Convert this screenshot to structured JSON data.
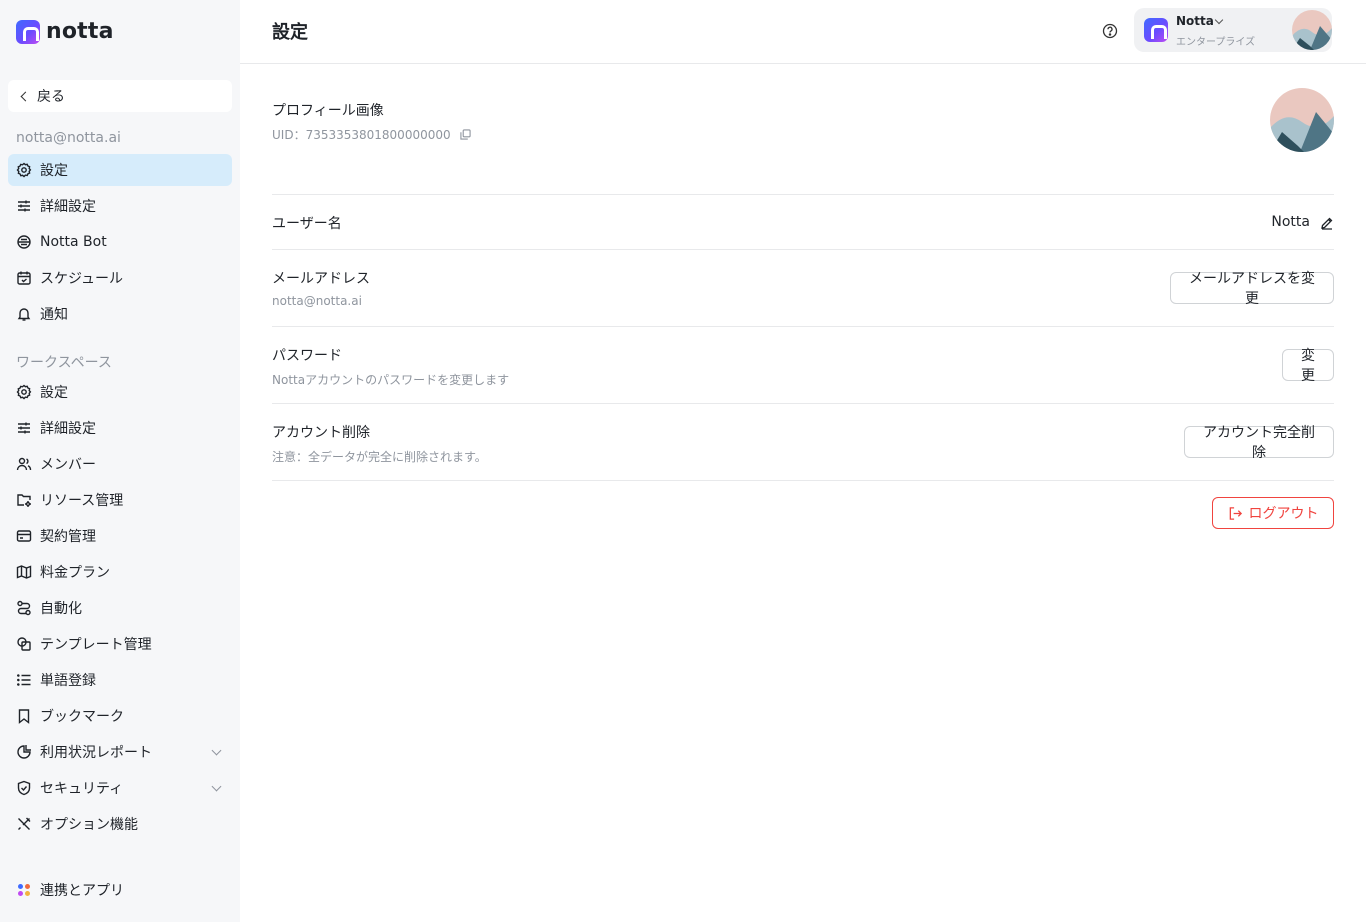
{
  "app": {
    "logo_text": "notta"
  },
  "sidebar": {
    "back_label": "戻る",
    "account_email": "notta@notta.ai",
    "personal_items": [
      {
        "label": "設定",
        "icon": "gear-icon",
        "active": true
      },
      {
        "label": "詳細設定",
        "icon": "sliders-icon"
      },
      {
        "label": "Notta Bot",
        "icon": "bot-icon"
      },
      {
        "label": "スケジュール",
        "icon": "calendar-icon"
      },
      {
        "label": "通知",
        "icon": "bell-icon"
      }
    ],
    "workspace_label": "ワークスペース",
    "workspace_items": [
      {
        "label": "設定",
        "icon": "gear-icon"
      },
      {
        "label": "詳細設定",
        "icon": "sliders-icon"
      },
      {
        "label": "メンバー",
        "icon": "users-icon"
      },
      {
        "label": "リソース管理",
        "icon": "folder-settings-icon"
      },
      {
        "label": "契約管理",
        "icon": "card-icon"
      },
      {
        "label": "料金プラン",
        "icon": "map-icon"
      },
      {
        "label": "自動化",
        "icon": "workflow-icon"
      },
      {
        "label": "テンプレート管理",
        "icon": "template-icon"
      },
      {
        "label": "単語登録",
        "icon": "list-icon"
      },
      {
        "label": "ブックマーク",
        "icon": "bookmark-icon"
      },
      {
        "label": "利用状況レポート",
        "icon": "pie-chart-icon",
        "expandable": true
      },
      {
        "label": "セキュリティ",
        "icon": "shield-check-icon",
        "expandable": true
      },
      {
        "label": "オプション機能",
        "icon": "tools-icon"
      }
    ],
    "integrations_label": "連携とアプリ"
  },
  "header": {
    "title": "設定",
    "account": {
      "name": "Notta",
      "plan": "エンタープライズ"
    }
  },
  "profile": {
    "title": "プロフィール画像",
    "uid_label": "UID：7353353801800000000"
  },
  "username": {
    "title": "ユーザー名",
    "value": "Notta"
  },
  "email": {
    "title": "メールアドレス",
    "value": "notta@notta.ai",
    "button": "メールアドレスを変更"
  },
  "password": {
    "title": "パスワード",
    "description": "Nottaアカウントのパスワードを変更します",
    "button": "変更"
  },
  "delete_account": {
    "title": "アカウント削除",
    "description": "注意：全データが完全に削除されます。",
    "button": "アカウント完全削除"
  },
  "logout": {
    "label": "ログアウト"
  },
  "colors": {
    "accent_active_bg": "#d6ecfb",
    "danger": "#f0443f",
    "sidebar_bg": "#f6f7f9"
  }
}
